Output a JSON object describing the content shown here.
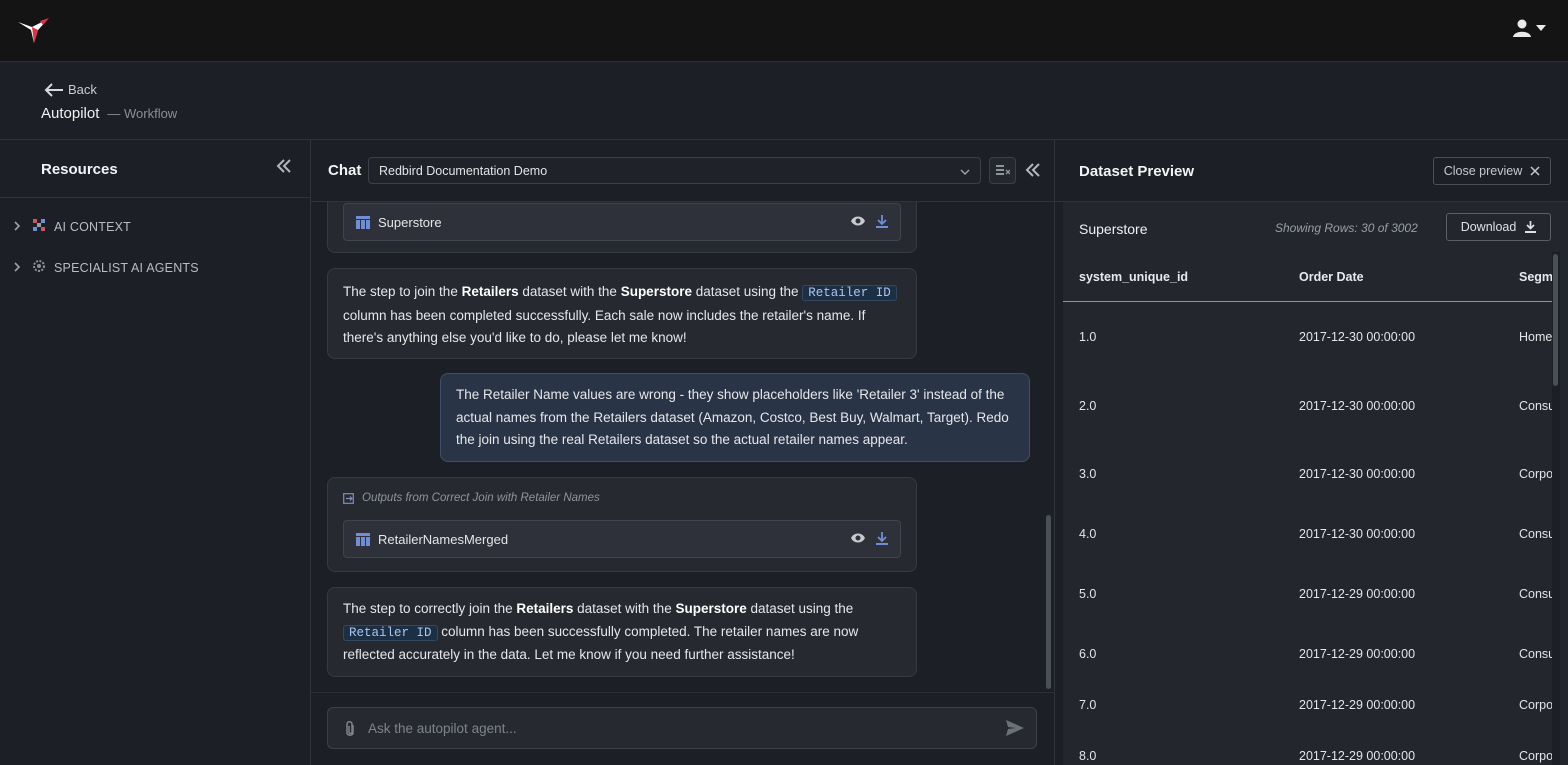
{
  "topbar": {
    "logo_icon": "hummingbird-icon",
    "user_icon": "user-icon"
  },
  "header": {
    "back_label": "Back",
    "title": "Autopilot",
    "subtitle": "— Workflow"
  },
  "resources": {
    "title": "Resources",
    "items": [
      {
        "label": "AI CONTEXT",
        "icon": "ai-context-icon"
      },
      {
        "label": "SPECIALIST AI AGENTS",
        "icon": "agent-gear-icon"
      }
    ]
  },
  "chat": {
    "title": "Chat",
    "selected_conversation": "Redbird Documentation Demo",
    "messages": {
      "file1": "Superstore",
      "assistant1": {
        "p1": "The step to join the ",
        "b1": "Retailers",
        "p2": " dataset with the ",
        "b2": "Superstore",
        "p3": " dataset using the ",
        "code": "Retailer ID",
        "p4": " column has been completed successfully. Each sale now includes the retailer's name. If there's anything else you'd like to do, please let me know!"
      },
      "user1": "The Retailer Name values are wrong - they show placeholders like 'Retailer 3' instead of the actual names from the Retailers dataset (Amazon, Costco, Best Buy, Walmart, Target). Redo the join using the real Retailers dataset so the actual retailer names appear.",
      "outputs_label": "Outputs from Correct Join with Retailer Names",
      "file2": "RetailerNamesMerged",
      "assistant2": {
        "p1": "The step to correctly join the ",
        "b1": "Retailers",
        "p2": " dataset with the ",
        "b2": "Superstore",
        "p3": " dataset using the ",
        "code": "Retailer ID",
        "p4": " column has been successfully completed. The retailer names are now reflected accurately in the data. Let me know if you need further assistance!"
      }
    },
    "composer_placeholder": "Ask the autopilot agent..."
  },
  "preview": {
    "title": "Dataset Preview",
    "close_label": "Close preview",
    "dataset_name": "Superstore",
    "rows_info": "Showing Rows: 30 of 3002",
    "download_label": "Download",
    "columns": [
      "system_unique_id",
      "Order Date",
      "Segment"
    ],
    "rows": [
      [
        "1.0",
        "2017-12-30 00:00:00",
        "Home Office"
      ],
      [
        "2.0",
        "2017-12-30 00:00:00",
        "Consumer"
      ],
      [
        "3.0",
        "2017-12-30 00:00:00",
        "Corporate"
      ],
      [
        "4.0",
        "2017-12-30 00:00:00",
        "Consumer"
      ],
      [
        "5.0",
        "2017-12-29 00:00:00",
        "Consumer"
      ],
      [
        "6.0",
        "2017-12-29 00:00:00",
        "Consumer"
      ],
      [
        "7.0",
        "2017-12-29 00:00:00",
        "Corporate"
      ],
      [
        "8.0",
        "2017-12-29 00:00:00",
        "Corporate"
      ]
    ]
  },
  "colors": {
    "accent": "#6f8ed6",
    "background": "#1c1f26",
    "topbar": "#141414",
    "user_bubble": "#2a3447"
  }
}
